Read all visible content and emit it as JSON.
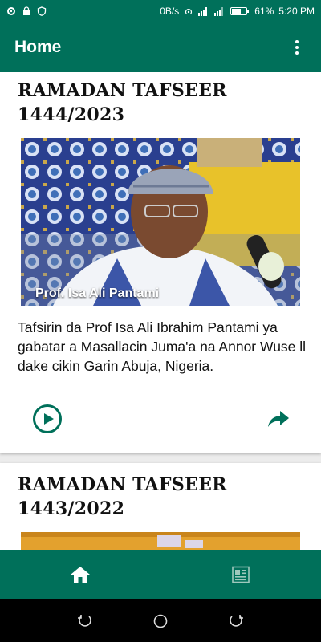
{
  "status_bar": {
    "speed": "0B/s",
    "battery": "61%",
    "time": "5:20 PM"
  },
  "app_bar": {
    "title": "Home",
    "overflow_icon": "more-vertical-icon"
  },
  "cards": [
    {
      "title": "RAMADAN TAFSEER 1444/2023",
      "thumbnail_caption": "Prof. Isa Ali Pantami",
      "description": "Tafsirin da Prof Isa Ali Ibrahim Pantami ya gabatar a Masallacin Juma'a na Annor Wuse ll dake cikin Garin Abuja, Nigeria.",
      "play_icon": "play-circle-icon",
      "share_icon": "share-icon"
    },
    {
      "title": "RAMADAN TAFSEER 1443/2022"
    }
  ],
  "bottom_nav": {
    "items": [
      {
        "icon": "home-icon",
        "active": true
      },
      {
        "icon": "newspaper-icon",
        "active": false
      }
    ]
  },
  "colors": {
    "primary": "#00705a",
    "accent": "#00705a"
  }
}
